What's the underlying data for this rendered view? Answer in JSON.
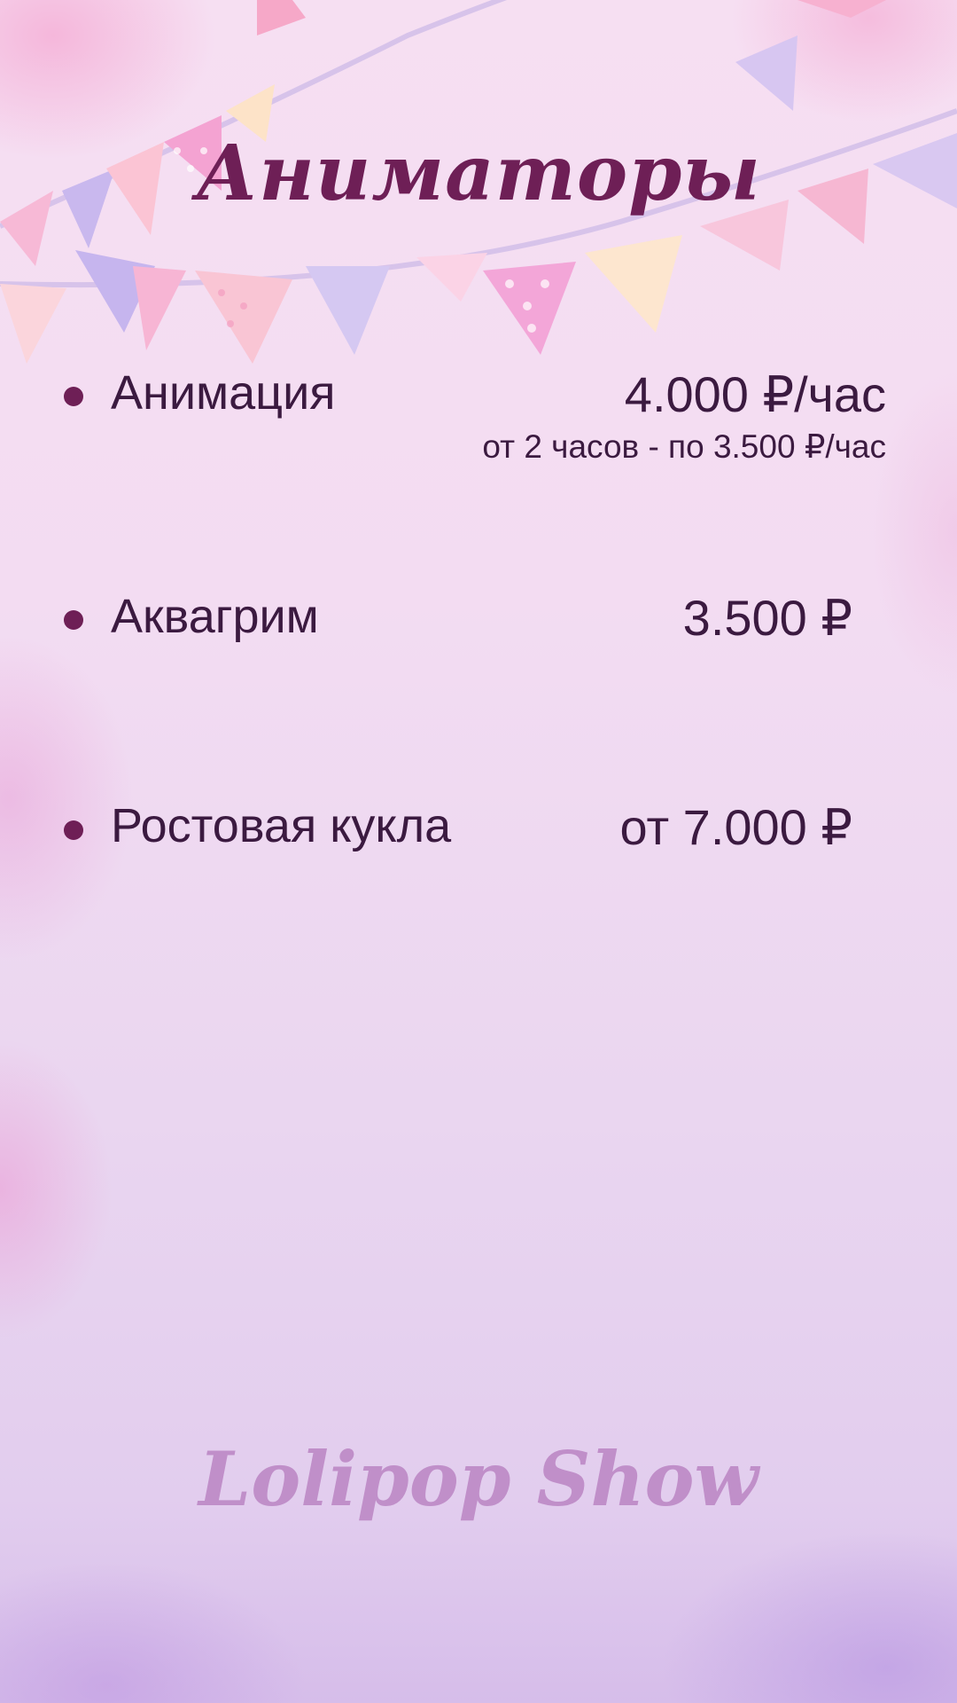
{
  "page": {
    "title": "Аниматоры",
    "footer_brand": "Lolipop Show"
  },
  "services": [
    {
      "name": "Анимация",
      "price": "4.000 ₽/час",
      "note": "от 2 часов - по 3.500 ₽/час"
    },
    {
      "name": "Аквагрим",
      "price": "3.500 ₽"
    },
    {
      "name": "Ростовая кукла",
      "price": "от 7.000 ₽"
    }
  ],
  "colors": {
    "accent": "#6e1f56",
    "text": "#3b1a40",
    "brand": "#c08fc9",
    "background": "#f3dcf2"
  },
  "icons": {
    "bullet": "bullet-dot-icon",
    "decoration": "bunting-garland-icon"
  }
}
